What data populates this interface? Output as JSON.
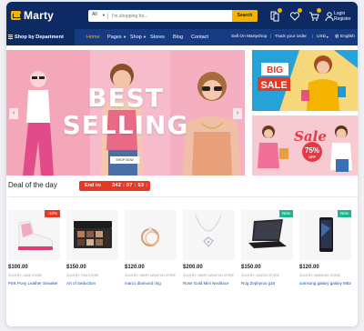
{
  "header": {
    "logo": "Marty",
    "search": {
      "category": "All",
      "placeholder": "I'm shopping for...",
      "button": "Search"
    },
    "login": {
      "line1": "Login",
      "line2": "Register"
    },
    "icons": [
      "compare-icon",
      "wishlist-icon",
      "cart-icon",
      "user-icon"
    ]
  },
  "nav": {
    "department": "Shop by Department",
    "links": [
      "Home",
      "Pages",
      "Shop",
      "Stores",
      "Blog",
      "Contact"
    ],
    "right": [
      "Sell On Martyshop",
      "Track your order",
      "USD",
      "English"
    ]
  },
  "hero": {
    "title_line1": "BEST",
    "title_line2": "SELLING",
    "button": "SHOP NOW"
  },
  "banners": {
    "top": {
      "line1": "BIG",
      "line2": "SALE"
    },
    "bottom": {
      "title": "Sale",
      "discount": "75%",
      "off": "OFF"
    }
  },
  "deal": {
    "title": "Deal of the day",
    "ends_label": "End in:",
    "time": "342 : 07 : 53 : 28"
  },
  "products": [
    {
      "price": "$100.00",
      "seller": "SOLD BY: LAVIE STORE",
      "name": "Pink Pony Leather Sneaker",
      "tag": "-10%",
      "tag_color": "#e53924"
    },
    {
      "price": "$150.00",
      "seller": "SOLD BY: FIKA STORE",
      "name": "Art of Seduction",
      "tag": "",
      "tag_color": ""
    },
    {
      "price": "$120.00",
      "seller": "SOLD BY: HARRY WINSTON STORE",
      "name": "marco diamond ring",
      "tag": "",
      "tag_color": ""
    },
    {
      "price": "$200.00",
      "seller": "SOLD BY: HARRY WINSTON STORE",
      "name": "Rose Gold Mini Necklace",
      "tag": "",
      "tag_color": ""
    },
    {
      "price": "$150.00",
      "seller": "SOLD BY: LENOVO STORE",
      "name": "Rog Zephyrus g15",
      "tag": "New",
      "tag_color": "#1fb58f"
    },
    {
      "price": "$120.00",
      "seller": "SOLD BY: SAMSUNG STORE",
      "name": "samsung galaxy galaxy M52",
      "tag": "New",
      "tag_color": "#1fb58f"
    }
  ],
  "colors": {
    "header": "#0d2a63",
    "nav": "#173b82",
    "accent": "#f4b400",
    "countdown": "#e53924",
    "link": "#1e4fa0"
  }
}
